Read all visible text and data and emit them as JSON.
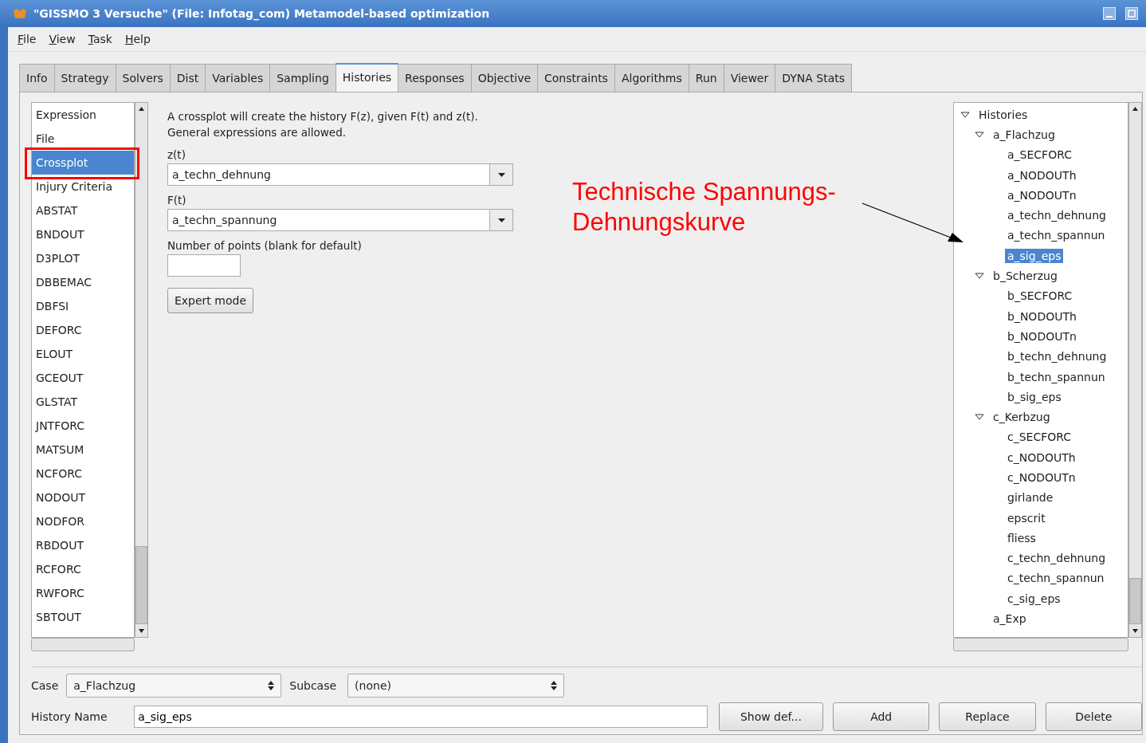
{
  "window": {
    "title": "\"GISSMO 3 Versuche\" (File: Infotag_com)  Metamodel-based optimization"
  },
  "menu": [
    "File",
    "View",
    "Task",
    "Help"
  ],
  "tabs": [
    {
      "label": "Info",
      "selected": false
    },
    {
      "label": "Strategy",
      "selected": false
    },
    {
      "label": "Solvers",
      "selected": false
    },
    {
      "label": "Dist",
      "selected": false
    },
    {
      "label": "Variables",
      "selected": false
    },
    {
      "label": "Sampling",
      "selected": false
    },
    {
      "label": "Histories",
      "selected": true
    },
    {
      "label": "Responses",
      "selected": false
    },
    {
      "label": "Objective",
      "selected": false
    },
    {
      "label": "Constraints",
      "selected": false
    },
    {
      "label": "Algorithms",
      "selected": false
    },
    {
      "label": "Run",
      "selected": false
    },
    {
      "label": "Viewer",
      "selected": false
    },
    {
      "label": "DYNA Stats",
      "selected": false
    }
  ],
  "source_list": [
    {
      "label": "Expression",
      "selected": false
    },
    {
      "label": "File",
      "selected": false
    },
    {
      "label": "Crossplot",
      "selected": true
    },
    {
      "label": "Injury Criteria",
      "selected": false
    },
    {
      "label": "ABSTAT",
      "selected": false
    },
    {
      "label": "BNDOUT",
      "selected": false
    },
    {
      "label": "D3PLOT",
      "selected": false
    },
    {
      "label": "DBBEMAC",
      "selected": false
    },
    {
      "label": "DBFSI",
      "selected": false
    },
    {
      "label": "DEFORC",
      "selected": false
    },
    {
      "label": "ELOUT",
      "selected": false
    },
    {
      "label": "GCEOUT",
      "selected": false
    },
    {
      "label": "GLSTAT",
      "selected": false
    },
    {
      "label": "JNTFORC",
      "selected": false
    },
    {
      "label": "MATSUM",
      "selected": false
    },
    {
      "label": "NCFORC",
      "selected": false
    },
    {
      "label": "NODOUT",
      "selected": false
    },
    {
      "label": "NODFOR",
      "selected": false
    },
    {
      "label": "RBDOUT",
      "selected": false
    },
    {
      "label": "RCFORC",
      "selected": false
    },
    {
      "label": "RWFORC",
      "selected": false
    },
    {
      "label": "SBTOUT",
      "selected": false
    }
  ],
  "form": {
    "description": [
      "A crossplot will create the history F(z), given F(t) and z(t).",
      "General expressions are allowed."
    ],
    "fields": [
      {
        "label": "z(t)",
        "kind": "dropdown",
        "value": "a_techn_dehnung"
      },
      {
        "label": "F(t)",
        "kind": "dropdown",
        "value": "a_techn_spannung"
      },
      {
        "label": "Number of points (blank for default)",
        "kind": "text"
      }
    ],
    "button": "Expert mode"
  },
  "annotation": {
    "lines": [
      "Technische Spannungs-",
      "Dehnungskurve"
    ]
  },
  "tree": {
    "label": "Histories",
    "expanded": true,
    "selected": false,
    "children": [
      {
        "label": "a_Flachzug",
        "expanded": true,
        "selected": false,
        "children": [
          {
            "label": "a_SECFORC",
            "selected": false
          },
          {
            "label": "a_NODOUTh",
            "selected": false
          },
          {
            "label": "a_NODOUTn",
            "selected": false
          },
          {
            "label": "a_techn_dehnung",
            "selected": false
          },
          {
            "label": "a_techn_spannun",
            "selected": false
          },
          {
            "label": "a_sig_eps",
            "selected": true
          }
        ]
      },
      {
        "label": "b_Scherzug",
        "expanded": true,
        "selected": false,
        "children": [
          {
            "label": "b_SECFORC",
            "selected": false
          },
          {
            "label": "b_NODOUTh",
            "selected": false
          },
          {
            "label": "b_NODOUTn",
            "selected": false
          },
          {
            "label": "b_techn_dehnung",
            "selected": false
          },
          {
            "label": "b_techn_spannun",
            "selected": false
          },
          {
            "label": "b_sig_eps",
            "selected": false
          }
        ]
      },
      {
        "label": "c_Kerbzug",
        "expanded": true,
        "selected": false,
        "children": [
          {
            "label": "c_SECFORC",
            "selected": false
          },
          {
            "label": "c_NODOUTh",
            "selected": false
          },
          {
            "label": "c_NODOUTn",
            "selected": false
          },
          {
            "label": "girlande",
            "selected": false
          },
          {
            "label": "epscrit",
            "selected": false
          },
          {
            "label": "fliess",
            "selected": false
          },
          {
            "label": "c_techn_dehnung",
            "selected": false
          },
          {
            "label": "c_techn_spannun",
            "selected": false
          },
          {
            "label": "c_sig_eps",
            "selected": false
          }
        ]
      },
      {
        "label": "a_Exp",
        "selected": false
      }
    ]
  },
  "case": {
    "label": "Case",
    "value": "a_Flachzug"
  },
  "subcase": {
    "label": "Subcase",
    "value": "(none)"
  },
  "history_name": {
    "label": "History Name",
    "value": "a_sig_eps"
  },
  "buttons": [
    "Show def...",
    "Add",
    "Replace",
    "Delete"
  ]
}
